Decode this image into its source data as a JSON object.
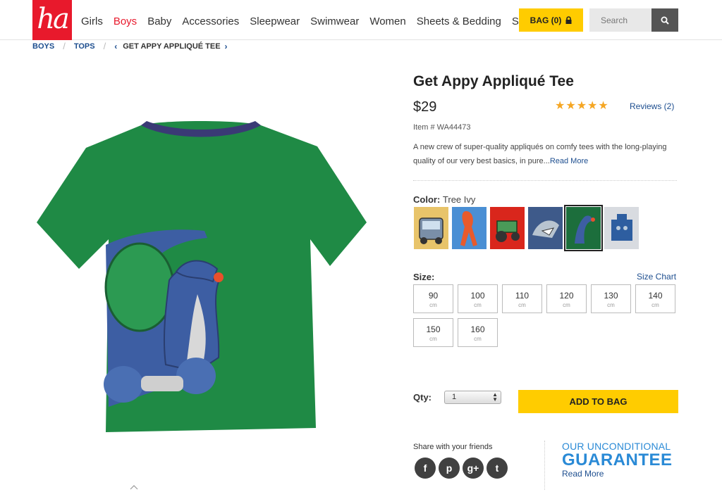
{
  "brand": {
    "logo_text": "ha",
    "accent": "#e8192c"
  },
  "nav": {
    "items": [
      {
        "label": "Girls"
      },
      {
        "label": "Boys",
        "active": true
      },
      {
        "label": "Baby"
      },
      {
        "label": "Accessories"
      },
      {
        "label": "Sleepwear"
      },
      {
        "label": "Swimwear"
      },
      {
        "label": "Women"
      },
      {
        "label": "Sheets & Bedding"
      },
      {
        "label": "Sale"
      }
    ]
  },
  "bag": {
    "label": "BAG (0)",
    "icon": "lock-icon",
    "color": "#ffcc00"
  },
  "search": {
    "placeholder": "Search",
    "icon": "search-icon"
  },
  "breadcrumb": {
    "items": [
      "BOYS",
      "TOPS"
    ],
    "current": "GET APPY APPLIQUÉ TEE"
  },
  "product": {
    "title": "Get Appy Appliqué Tee",
    "price": "$29",
    "rating": "★★★★★",
    "reviews": "Reviews (2)",
    "item_number": "Item # WA44473",
    "description": "A new crew of super-quality appliqués on comfy tees with the long-playing quality of our very best basics, in pure...",
    "read_more": "Read More",
    "color_label": "Color:",
    "color_value": "Tree Ivy",
    "swatches": [
      {
        "name": "truck",
        "bg": "#e8c46a",
        "selected": false
      },
      {
        "name": "squid",
        "bg": "#4a8fd4",
        "selected": false
      },
      {
        "name": "tractor",
        "bg": "#d9261c",
        "selected": false
      },
      {
        "name": "shark",
        "bg": "#3e5a8a",
        "selected": false
      },
      {
        "name": "dragon",
        "bg": "#1c6e3c",
        "selected": true
      },
      {
        "name": "robot",
        "bg": "#d8dbe0",
        "selected": false
      }
    ],
    "size_label": "Size:",
    "size_chart": "Size Chart",
    "sizes": [
      {
        "num": "90",
        "unit": "cm"
      },
      {
        "num": "100",
        "unit": "cm"
      },
      {
        "num": "110",
        "unit": "cm"
      },
      {
        "num": "120",
        "unit": "cm"
      },
      {
        "num": "130",
        "unit": "cm"
      },
      {
        "num": "140",
        "unit": "cm"
      },
      {
        "num": "150",
        "unit": "cm"
      },
      {
        "num": "160",
        "unit": "cm"
      }
    ],
    "qty_label": "Qty:",
    "qty_value": "1",
    "add_to_bag": "ADD TO BAG"
  },
  "share": {
    "label": "Share with your friends",
    "icons": [
      {
        "name": "facebook-icon",
        "glyph": "f"
      },
      {
        "name": "pinterest-icon",
        "glyph": "p"
      },
      {
        "name": "google-plus-icon",
        "glyph": "g+"
      },
      {
        "name": "twitter-icon",
        "glyph": "t"
      }
    ]
  },
  "guarantee": {
    "top": "OUR UNCONDITIONAL",
    "main": "GUARANTEE",
    "more": "Read More",
    "color": "#2a8ad6"
  }
}
